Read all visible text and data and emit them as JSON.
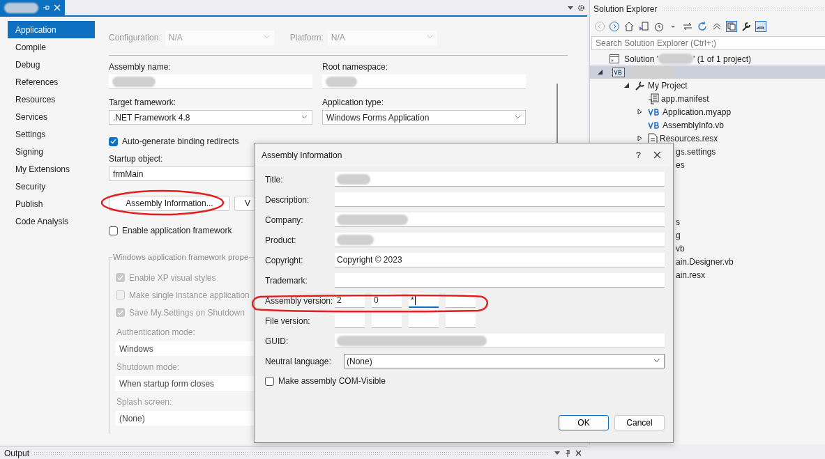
{
  "document_tab": {
    "pinned": true
  },
  "nav": [
    {
      "label": "Application",
      "selected": true
    },
    {
      "label": "Compile",
      "selected": false
    },
    {
      "label": "Debug",
      "selected": false
    },
    {
      "label": "References",
      "selected": false
    },
    {
      "label": "Resources",
      "selected": false
    },
    {
      "label": "Services",
      "selected": false
    },
    {
      "label": "Settings",
      "selected": false
    },
    {
      "label": "Signing",
      "selected": false
    },
    {
      "label": "My Extensions",
      "selected": false
    },
    {
      "label": "Security",
      "selected": false
    },
    {
      "label": "Publish",
      "selected": false
    },
    {
      "label": "Code Analysis",
      "selected": false
    }
  ],
  "configuration": {
    "label": "Configuration:",
    "value": "N/A"
  },
  "platform": {
    "label": "Platform:",
    "value": "N/A"
  },
  "assembly_name": {
    "label": "Assembly name:"
  },
  "root_namespace": {
    "label": "Root namespace:"
  },
  "target_framework": {
    "label": "Target framework:",
    "value": ".NET Framework 4.8"
  },
  "application_type": {
    "label": "Application type:",
    "value": "Windows Forms Application"
  },
  "auto_generate": {
    "label": "Auto-generate binding redirects",
    "checked": true
  },
  "startup_object": {
    "label": "Startup object:",
    "value": "frmMain"
  },
  "buttons": [
    "Assembly Information...",
    "V"
  ],
  "enable_framework": {
    "label": "Enable application framework",
    "checked": false
  },
  "framework_group": {
    "title": "Windows application framework prope",
    "options": [
      {
        "label": "Enable XP visual styles",
        "checked": true
      },
      {
        "label": "Make single instance application",
        "checked": false
      },
      {
        "label": "Save My.Settings on Shutdown",
        "checked": true
      }
    ],
    "selects": [
      {
        "label": "Authentication mode:",
        "value": "Windows"
      },
      {
        "label": "Shutdown mode:",
        "value": "When startup form closes"
      },
      {
        "label": "Splash screen:",
        "value": "(None)"
      }
    ]
  },
  "solution_explorer": {
    "title": "Solution Explorer",
    "search_placeholder": "Search Solution Explorer (Ctrl+;)",
    "solution": {
      "label_start": "Solution '",
      "label_end": "' (1 of 1 project)"
    },
    "project": {
      "expanded": true,
      "selected": true,
      "children": [
        {
          "label": "My Project",
          "kind": "folder",
          "expanded": true,
          "children": [
            {
              "label": "app.manifest",
              "kind": "manifest"
            },
            {
              "label": "Application.myapp",
              "kind": "vb",
              "expanded": false
            },
            {
              "label": "AssemblyInfo.vb",
              "kind": "vb"
            },
            {
              "label": "Resources.resx",
              "kind": "resx",
              "expanded": false
            }
          ]
        }
      ]
    },
    "covered_groups": [
      [
        "gs.settings",
        "es"
      ],
      [
        "s",
        "g",
        "vb",
        "ain.Designer.vb",
        "ain.resx"
      ]
    ]
  },
  "dialog": {
    "title": "Assembly Information",
    "help": "?",
    "fields": [
      {
        "label": "Title:"
      },
      {
        "label": "Description:"
      },
      {
        "label": "Company:"
      },
      {
        "label": "Product:"
      },
      {
        "label": "Copyright:",
        "value": "Copyright © 2023"
      },
      {
        "label": "Trademark:"
      }
    ],
    "versions": [
      {
        "label": "Assembly version:",
        "parts": [
          {
            "value": "2",
            "focused": false
          },
          {
            "value": "0",
            "focused": false
          },
          {
            "value": "*",
            "focused": true
          },
          {
            "focused": false
          }
        ]
      },
      {
        "label": "File version:",
        "parts": [
          {
            "focused": false
          },
          {
            "focused": false
          },
          {
            "focused": false
          },
          {
            "focused": false
          }
        ]
      }
    ],
    "guid": {
      "label": "GUID:"
    },
    "neutral_language": {
      "label": "Neutral language:",
      "value": "(None)"
    },
    "com_visible": {
      "label": "Make assembly COM-Visible",
      "checked": false
    },
    "buttons": [
      {
        "label": "OK",
        "default": true
      },
      {
        "label": "Cancel",
        "default": false
      }
    ]
  },
  "output": {
    "title": "Output"
  }
}
